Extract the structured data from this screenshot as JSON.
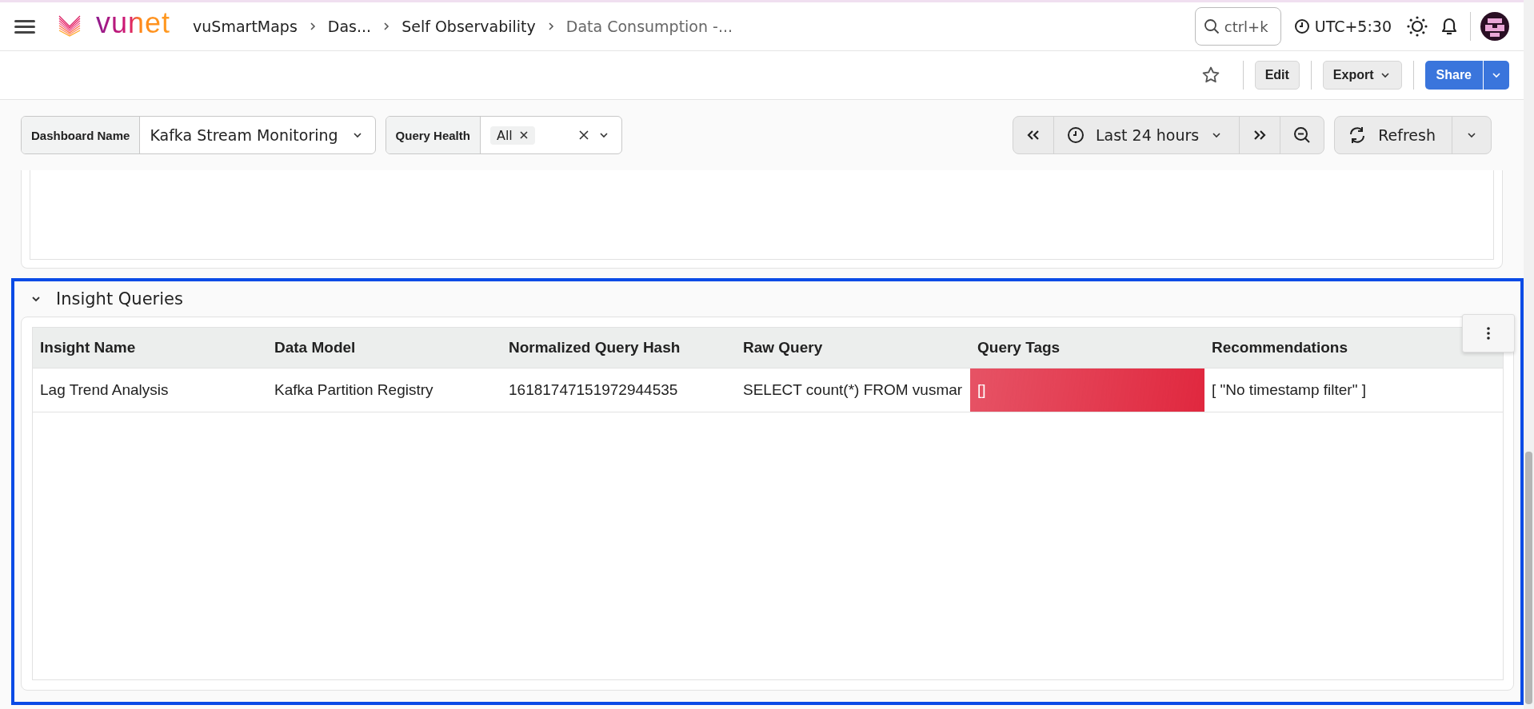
{
  "header": {
    "logo": "vunet",
    "breadcrumbs": [
      {
        "label": "vuSmartMaps",
        "current": false
      },
      {
        "label": "Das...",
        "current": false
      },
      {
        "label": "Self Observability",
        "current": false
      },
      {
        "label": "Data Consumption -...",
        "current": true
      }
    ],
    "search": {
      "placeholder": "ctrl+k"
    },
    "timezone": "UTC+5:30"
  },
  "toolbar": {
    "buttons": [
      {
        "label": "Edit",
        "kind": "plain"
      },
      {
        "label": "Export",
        "kind": "dropdown"
      },
      {
        "label": "Share",
        "kind": "split"
      }
    ]
  },
  "filters": [
    {
      "label": "Dashboard Name",
      "kind": "select",
      "value": "Kafka Stream Monitoring"
    },
    {
      "label": "Query Health",
      "kind": "multi",
      "chips": [
        "All"
      ]
    }
  ],
  "time_range": {
    "label": "Last 24 hours"
  },
  "refresh": {
    "label": "Refresh"
  },
  "section": {
    "title": "Insight Queries",
    "expanded": true,
    "selected": true,
    "table": {
      "columns": [
        "Insight Name",
        "Data Model",
        "Normalized Query Hash",
        "Raw Query",
        "Query Tags",
        "Recommendations"
      ],
      "rows": [
        [
          {
            "text": "Lag Trend Analysis"
          },
          {
            "text": "Kafka Partition Registry"
          },
          {
            "text": "16181747151972944535"
          },
          {
            "text": "SELECT count(*) FROM vusmar"
          },
          {
            "text": "[]",
            "color": "#e0283f"
          },
          {
            "text": "[ \"No timestamp filter\" ]"
          }
        ]
      ]
    }
  }
}
